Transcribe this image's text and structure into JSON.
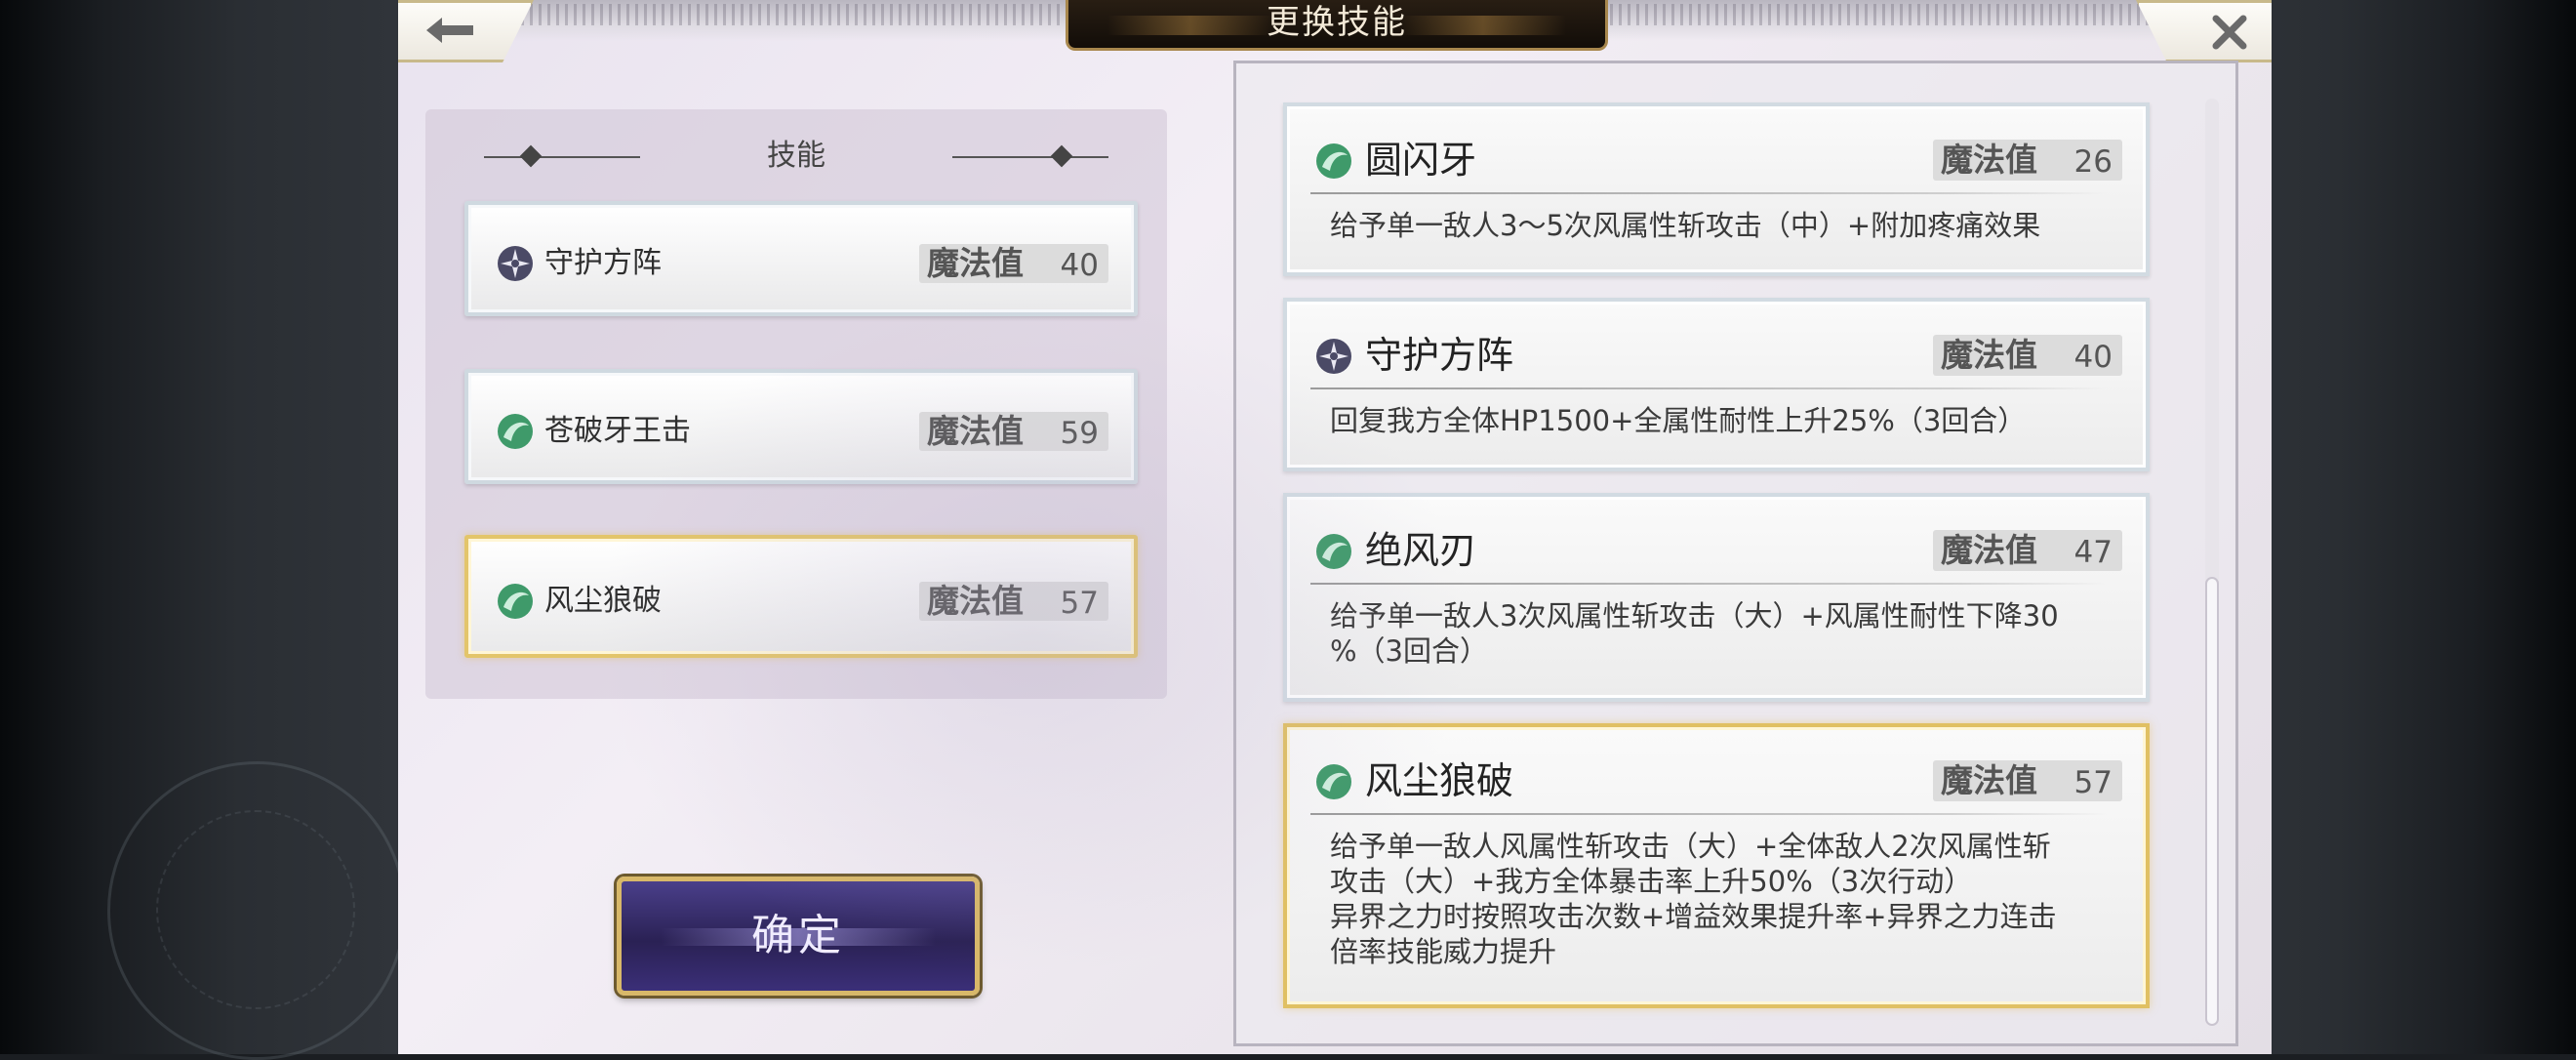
{
  "title": "更换技能",
  "colors": {
    "accent_gold": "#e0c063",
    "wind_icon": "#3f9a6a",
    "guard_icon": "#4b4a66",
    "confirm_bg": "#2a2154"
  },
  "equipped": {
    "header": "技能",
    "slots": [
      {
        "name": "守护方阵",
        "icon": "shield-guard-icon",
        "mp_label": "魔法值",
        "mp": "40",
        "selected": false
      },
      {
        "name": "苍破牙王击",
        "icon": "wind-element-icon",
        "mp_label": "魔法值",
        "mp": "59",
        "selected": false
      },
      {
        "name": "风尘狼破",
        "icon": "wind-element-icon",
        "mp_label": "魔法值",
        "mp": "57",
        "selected": true
      }
    ],
    "confirm_label": "确定"
  },
  "skill_list": [
    {
      "name": "圆闪牙",
      "icon": "wind-element-icon",
      "mp_label": "魔法值",
      "mp": "26",
      "desc": "给予单一敌人3～5次风属性斩攻击（中）+附加疼痛效果",
      "selected": false
    },
    {
      "name": "守护方阵",
      "icon": "shield-guard-icon",
      "mp_label": "魔法值",
      "mp": "40",
      "desc": "回复我方全体HP1500+全属性耐性上升25%（3回合）",
      "selected": false
    },
    {
      "name": "绝风刃",
      "icon": "wind-element-icon",
      "mp_label": "魔法值",
      "mp": "47",
      "desc": "给予单一敌人3次风属性斩攻击（大）+风属性耐性下降30\n%（3回合）",
      "selected": false
    },
    {
      "name": "风尘狼破",
      "icon": "wind-element-icon",
      "mp_label": "魔法值",
      "mp": "57",
      "desc": "给予单一敌人风属性斩攻击（大）+全体敌人2次风属性斩\n攻击（大）+我方全体暴击率上升50%（3次行动）\n异界之力时按照攻击次数+增益效果提升率+异界之力连击\n倍率技能威力提升",
      "selected": true
    }
  ]
}
